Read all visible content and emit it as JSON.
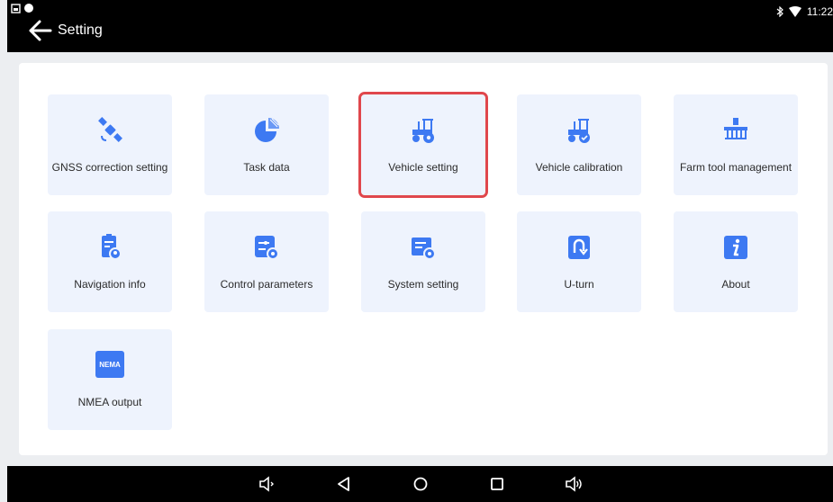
{
  "header": {
    "title": "Setting",
    "time": "11:22"
  },
  "tiles": [
    {
      "label": "GNSS correction setting"
    },
    {
      "label": "Task data"
    },
    {
      "label": "Vehicle setting",
      "selected": true
    },
    {
      "label": "Vehicle calibration"
    },
    {
      "label": "Farm tool management"
    },
    {
      "label": "Navigation info"
    },
    {
      "label": "Control parameters"
    },
    {
      "label": "System setting"
    },
    {
      "label": "U-turn"
    },
    {
      "label": "About"
    },
    {
      "label": "NMEA output",
      "badge": "NEMA"
    }
  ],
  "colors": {
    "accent": "#3d79f2",
    "tile_bg": "#eef3fd",
    "highlight": "#e0474c"
  }
}
